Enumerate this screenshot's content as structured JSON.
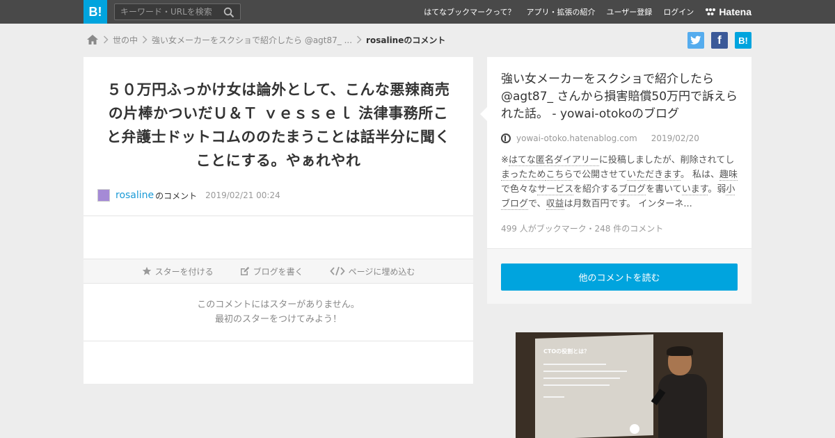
{
  "header": {
    "logo_text": "B!",
    "search_placeholder": "キーワード・URLを検索",
    "nav": [
      "はてなブックマークって？",
      "アプリ・拡張の紹介",
      "ユーザー登録",
      "ログイン"
    ],
    "brand": "Hatena"
  },
  "breadcrumb": {
    "items": [
      "世の中",
      "強い女メーカーをスクショで紹介したら @agt87_ ..."
    ],
    "current": "rosalineのコメント"
  },
  "share": {
    "twitter_color": "#55acee",
    "facebook_color": "#3b5998",
    "hatena_color": "#00a4de",
    "hatena_label": "B!"
  },
  "comment": {
    "text": "５０万円ふっかけ女は論外として、こんな悪辣商売の片棒かついだＵ＆Ｔ ｖｅｓｓｅｌ 法律事務所こと弁護士ドットコムののたまうことは話半分に聞くことにする。やぁれやれ",
    "user": "rosaline",
    "user_suffix": "のコメント",
    "date": "2019/02/21 00:24"
  },
  "actions": {
    "star": "スターを付ける",
    "blog": "ブログを書く",
    "embed": "ページに埋め込む"
  },
  "stars_empty": {
    "line1": "このコメントにはスターがありません。",
    "line2": "最初のスターをつけてみよう！"
  },
  "entry": {
    "title": "強い女メーカーをスクショで紹介したら@agt87_ さんから損害賠償50万円で訴えられた話。 - yowai-otokoのブログ",
    "domain": "yowai-otoko.hatenablog.com",
    "date": "2019/02/20",
    "excerpt_parts": [
      {
        "t": "※",
        "k": false
      },
      {
        "t": "はてな匿名ダイアリー",
        "k": true
      },
      {
        "t": "に投稿しましたが、削除されてし",
        "k": false
      },
      {
        "t": "まったため",
        "k": true
      },
      {
        "t": "こちら",
        "k": true
      },
      {
        "t": "で公開させて",
        "k": false
      },
      {
        "t": "いただきます",
        "k": true
      },
      {
        "t": "。 私は、",
        "k": false
      },
      {
        "t": "趣味",
        "k": true
      },
      {
        "t": "で色々な",
        "k": false
      },
      {
        "t": "サービス",
        "k": true
      },
      {
        "t": "を紹介する",
        "k": false
      },
      {
        "t": "ブログ",
        "k": true
      },
      {
        "t": "を書いて",
        "k": false
      },
      {
        "t": "います",
        "k": true
      },
      {
        "t": "。弱",
        "k": false
      },
      {
        "t": "小",
        "k": true
      },
      {
        "t": "ブログ",
        "k": true
      },
      {
        "t": "で、",
        "k": false
      },
      {
        "t": "収益",
        "k": true
      },
      {
        "t": "は月数百円です。 インターネ...",
        "k": false
      }
    ],
    "count": "499 人がブックマーク・248 件のコメント",
    "read_more": "他のコメントを読む"
  },
  "photo": {
    "slide_title": "CTOの役割とは？"
  }
}
